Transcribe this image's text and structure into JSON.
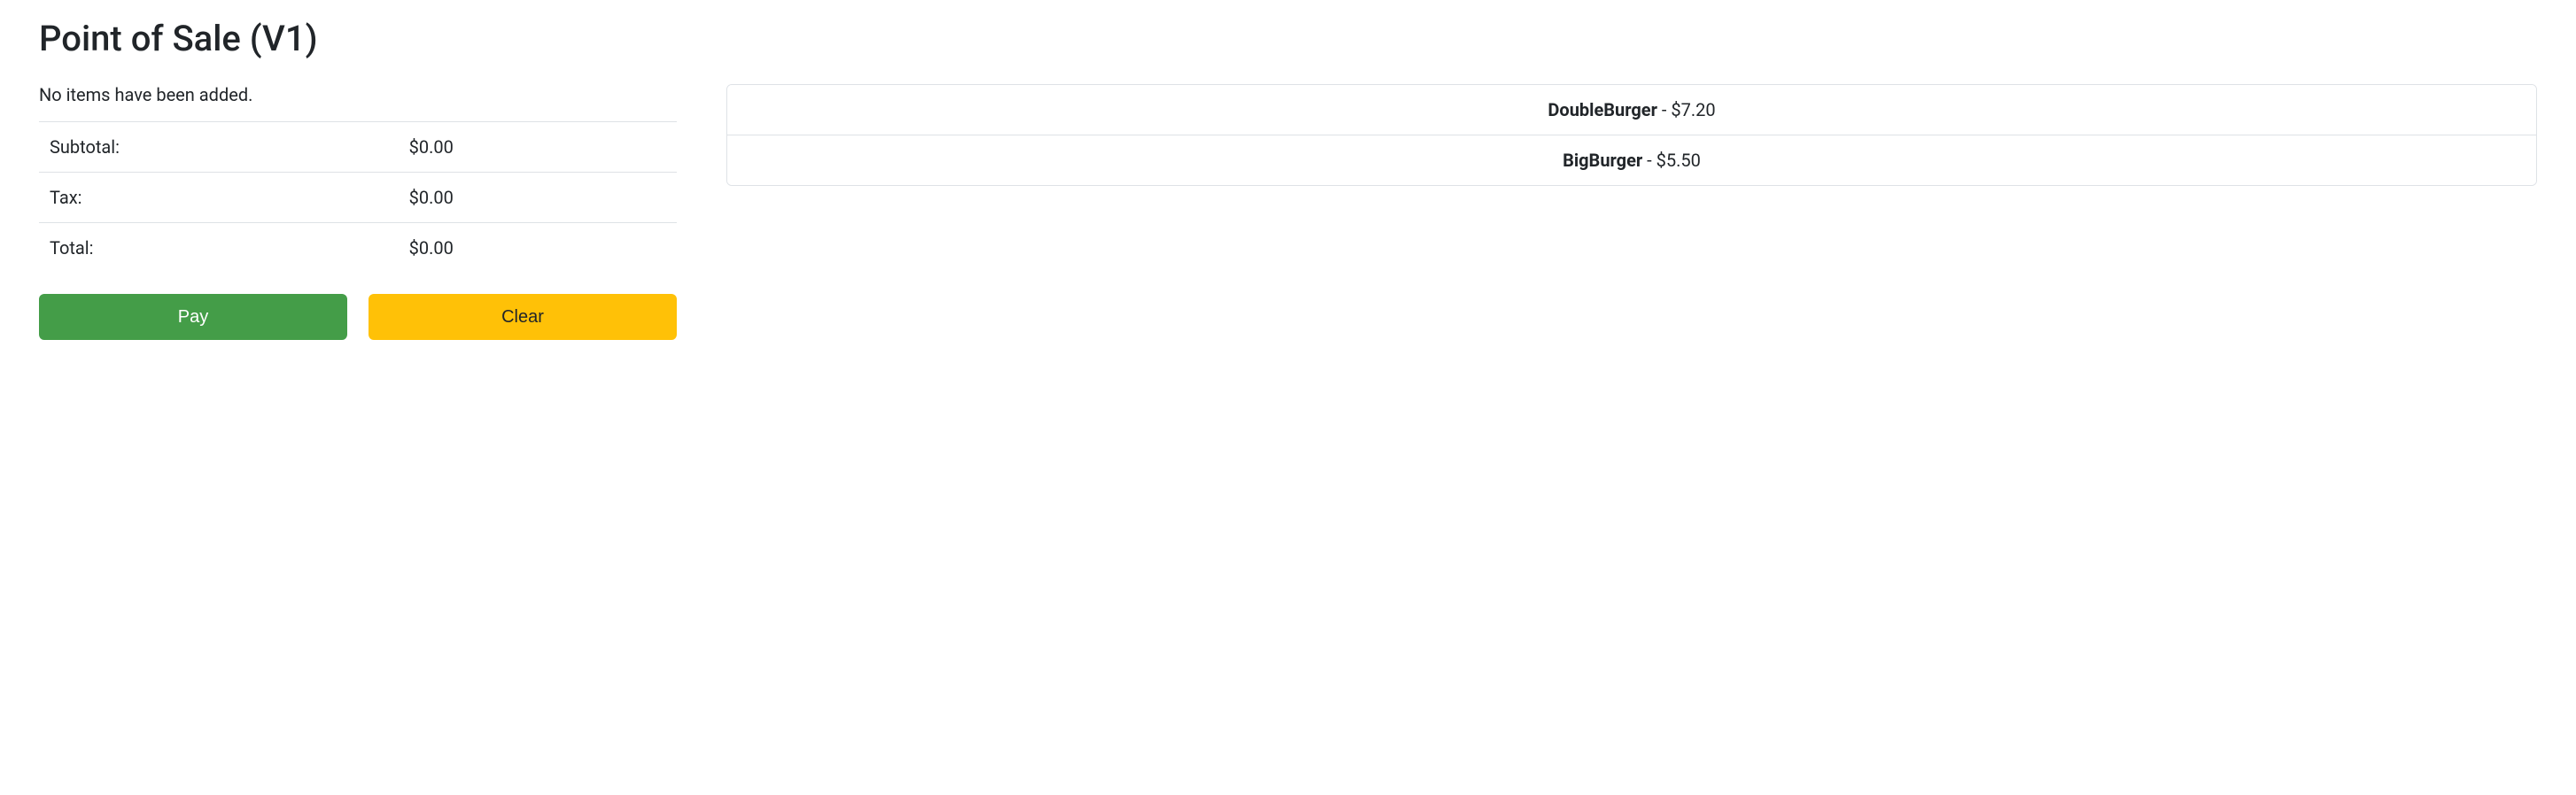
{
  "header": {
    "title": "Point of Sale (V1)"
  },
  "cart": {
    "empty_message": "No items have been added.",
    "rows": [
      {
        "label": "Subtotal:",
        "amount": "$0.00"
      },
      {
        "label": "Tax:",
        "amount": "$0.00"
      },
      {
        "label": "Total:",
        "amount": "$0.00"
      }
    ],
    "buttons": {
      "pay": "Pay",
      "clear": "Clear"
    }
  },
  "menu": {
    "items": [
      {
        "name": "DoubleBurger",
        "sep": " - ",
        "price": "$7.20"
      },
      {
        "name": "BigBurger",
        "sep": " - ",
        "price": "$5.50"
      }
    ]
  }
}
